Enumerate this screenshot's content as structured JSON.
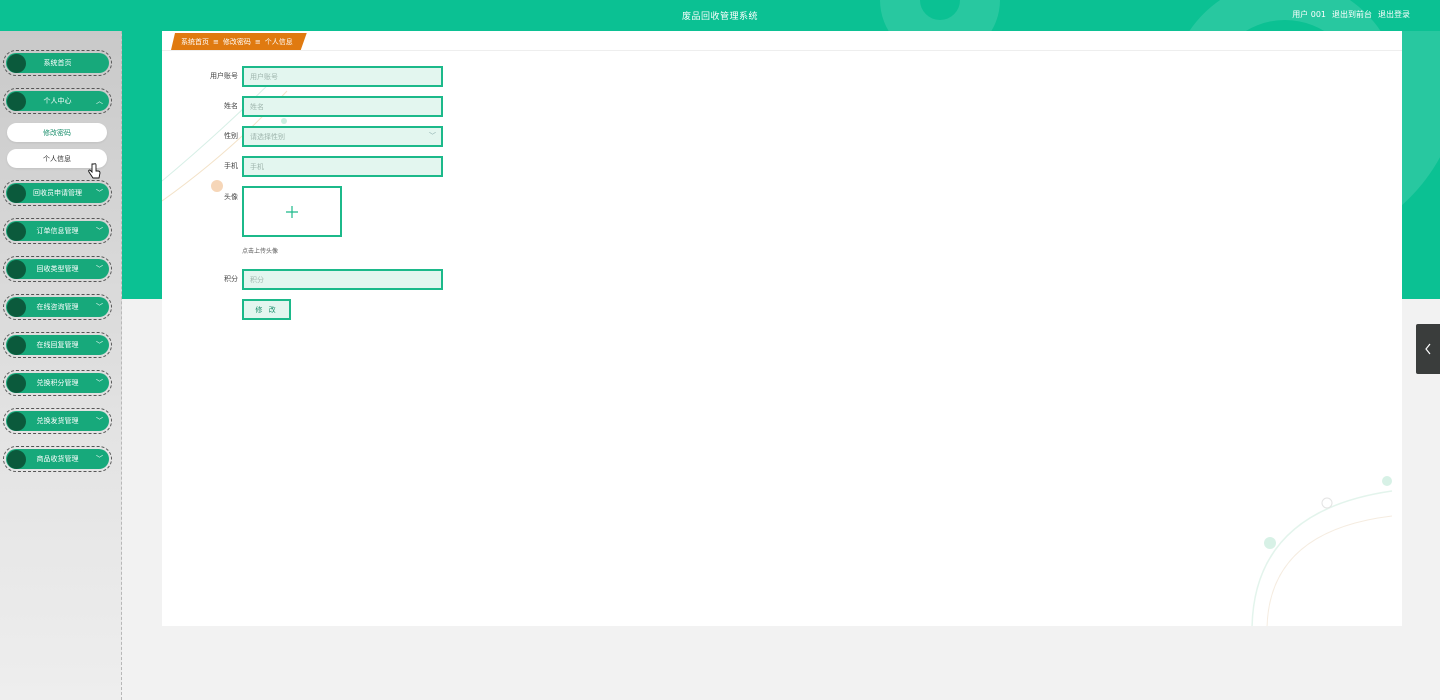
{
  "header": {
    "title": "废品回收管理系统",
    "user_label": "用户 001",
    "back_label": "退出到前台",
    "logout_label": "退出登录"
  },
  "sidebar": {
    "items": [
      {
        "label": "系统首页"
      },
      {
        "label": "个人中心",
        "expanded": true
      },
      {
        "label": "回收员申请管理"
      },
      {
        "label": "订单信息管理"
      },
      {
        "label": "回收类型管理"
      },
      {
        "label": "在线咨询管理"
      },
      {
        "label": "在线回复管理"
      },
      {
        "label": "兑换积分管理"
      },
      {
        "label": "兑换发货管理"
      },
      {
        "label": "商品收货管理"
      }
    ],
    "submenu": [
      {
        "label": "修改密码"
      },
      {
        "label": "个人信息"
      }
    ]
  },
  "breadcrumb": {
    "items": [
      "系统首页",
      "修改密码",
      "个人信息"
    ],
    "separator": "≡"
  },
  "form": {
    "account_label": "用户账号",
    "account_placeholder": "用户账号",
    "name_label": "姓名",
    "name_placeholder": "姓名",
    "gender_label": "性别",
    "gender_placeholder": "请选择性别",
    "phone_label": "手机",
    "phone_placeholder": "手机",
    "avatar_label": "头像",
    "avatar_hint": "点击上传头像",
    "points_label": "积分",
    "points_placeholder": "积分",
    "submit_label": "修 改"
  },
  "colors": {
    "primary": "#0bc193",
    "menu": "#17a97b",
    "breadcrumb": "#e07a10"
  }
}
